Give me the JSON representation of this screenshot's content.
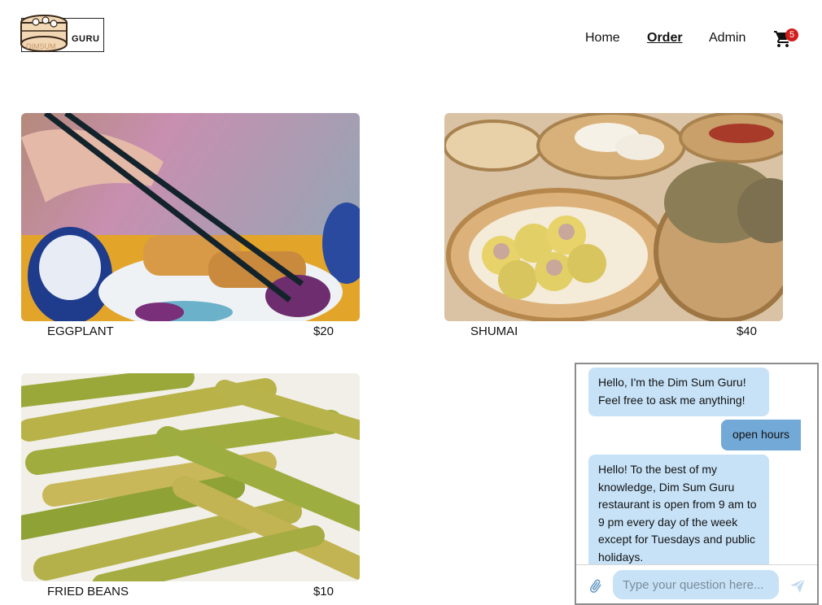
{
  "header": {
    "logo_text": "GURU",
    "logo_subtext": "DIMSUM",
    "nav": [
      {
        "label": "Home",
        "active": false
      },
      {
        "label": "Order",
        "active": true
      },
      {
        "label": "Admin",
        "active": false
      }
    ],
    "cart_icon": "cart-icon",
    "cart_count": "5"
  },
  "products": [
    {
      "name": "EGGPLANT",
      "price": "$20",
      "image": "eggplant-photo"
    },
    {
      "name": "SHUMAI",
      "price": "$40",
      "image": "shumai-photo"
    },
    {
      "name": "FRIED BEANS",
      "price": "$10",
      "image": "fried-beans-photo"
    }
  ],
  "chat": {
    "messages": [
      {
        "from": "bot",
        "text": "Hello, I'm the Dim Sum Guru! Feel free to ask me anything!"
      },
      {
        "from": "user",
        "text": "open hours"
      },
      {
        "from": "bot",
        "text": "Hello! To the best of my knowledge, Dim Sum Guru restaurant is open from 9 am to 9 pm every day of the week except for Tuesdays and public holidays."
      }
    ],
    "input_placeholder": "Type your question here...",
    "attach_icon": "paperclip-icon",
    "send_icon": "send-icon"
  },
  "colors": {
    "bot_bubble": "#c7e2f7",
    "user_bubble": "#73a9d7",
    "badge": "#d21d1d"
  }
}
